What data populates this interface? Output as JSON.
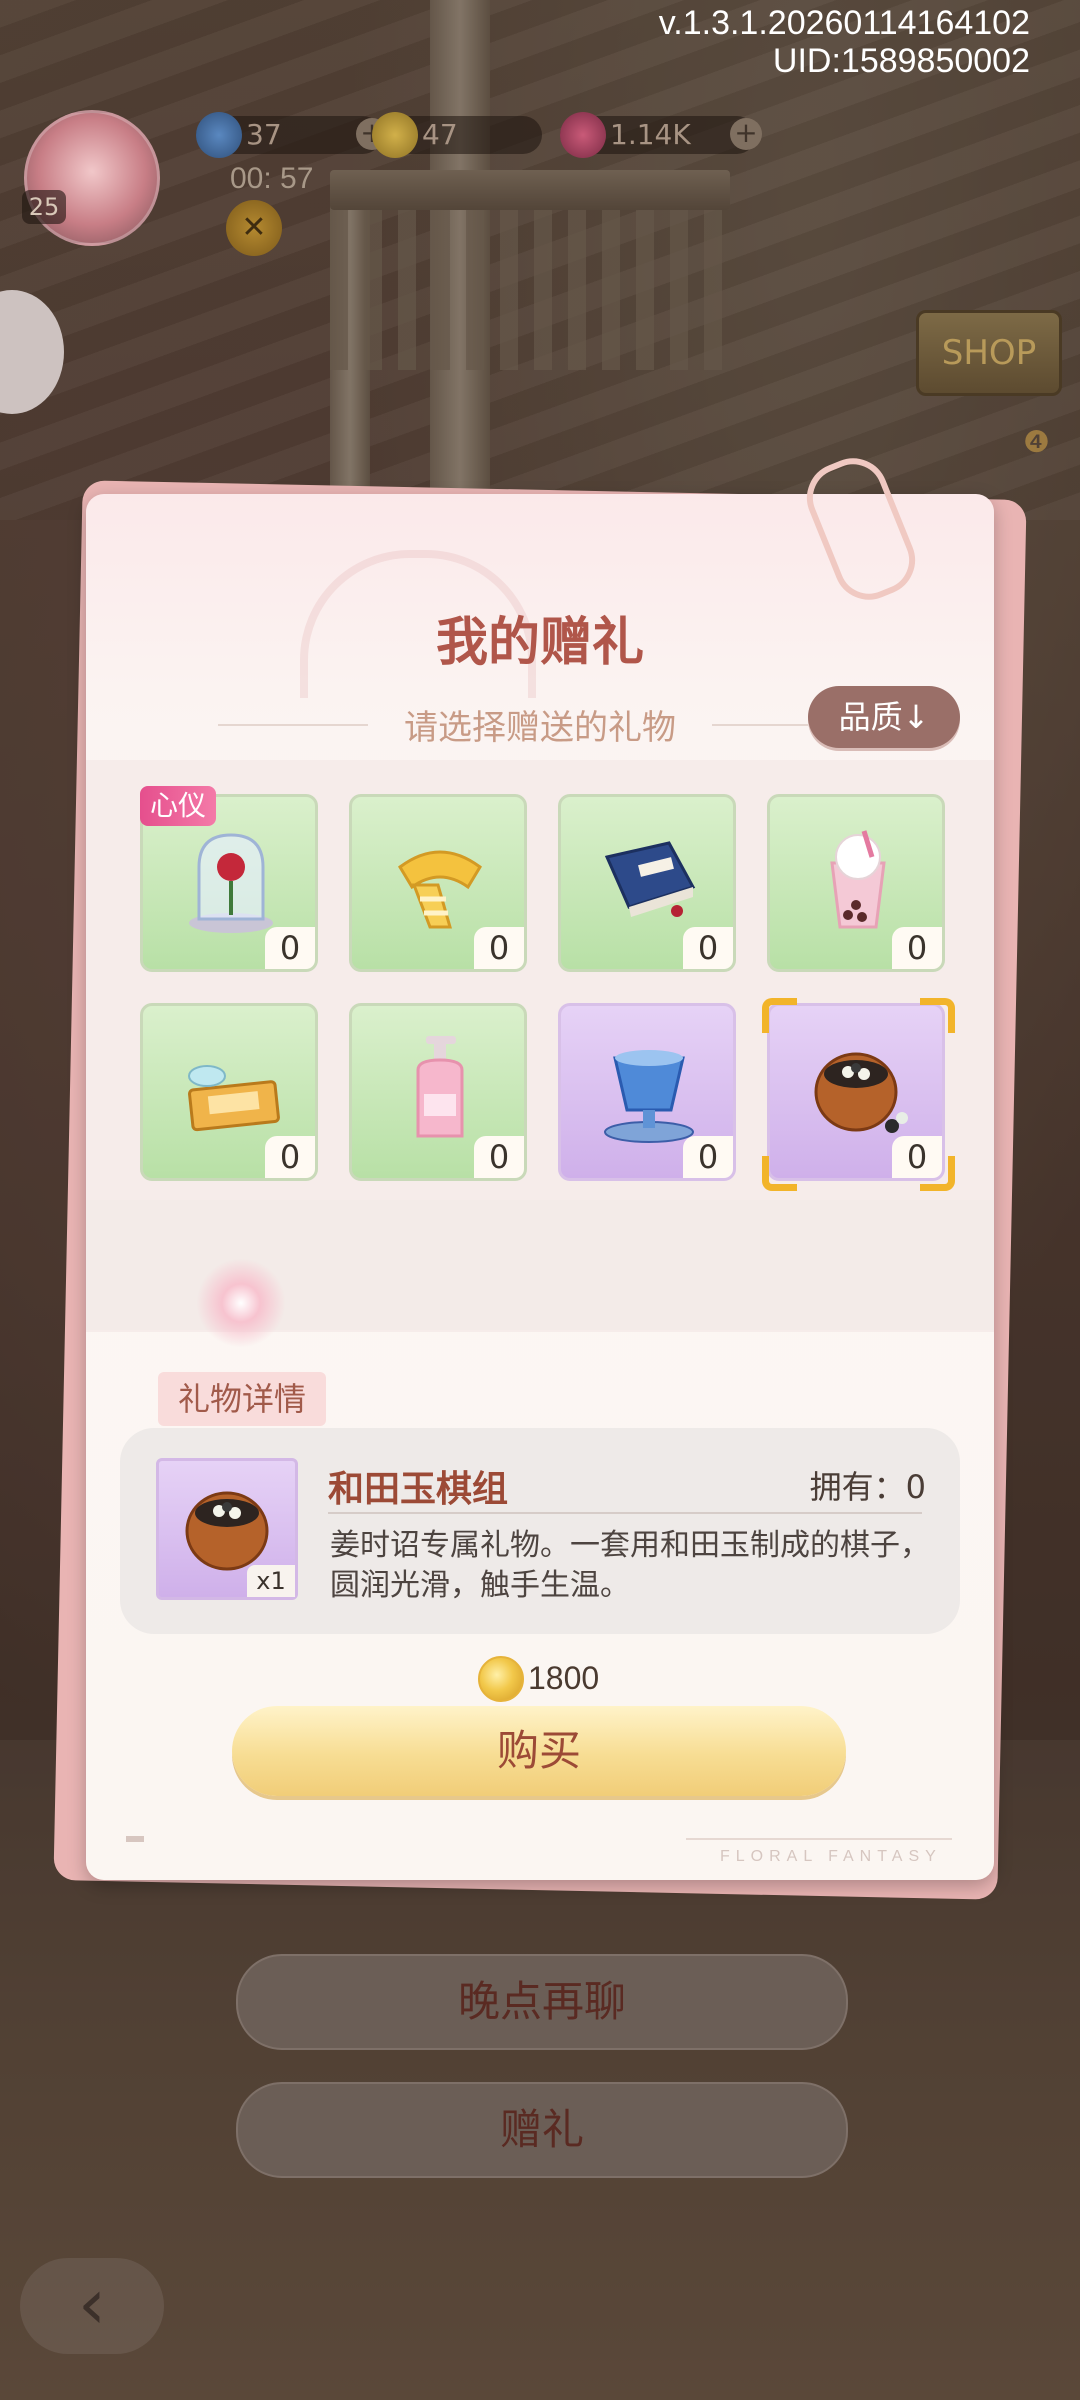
{
  "hud": {
    "version": "v.1.3.1.20260114164102",
    "uid": "UID:1589850002",
    "level": "25",
    "energy": "37",
    "coins": "47",
    "gems": "1.14K",
    "timer": "00: 57"
  },
  "modal": {
    "title": "我的赠礼",
    "subtitle": "请选择赠送的礼物",
    "sort_label": "品质↓",
    "items": [
      {
        "icon": "rose-dome-icon",
        "count": "0",
        "tag": "心仪",
        "style": "green"
      },
      {
        "icon": "scarf-icon",
        "count": "0",
        "style": "green"
      },
      {
        "icon": "book-icon",
        "count": "0",
        "style": "green"
      },
      {
        "icon": "milk-tea-icon",
        "count": "0",
        "style": "green"
      },
      {
        "icon": "wish-ticket-icon",
        "count": "0",
        "style": "green"
      },
      {
        "icon": "lotion-bottle-icon",
        "count": "0",
        "style": "green"
      },
      {
        "icon": "crystal-cup-icon",
        "count": "0",
        "style": "purple"
      },
      {
        "icon": "go-stones-icon",
        "count": "0",
        "style": "purple",
        "selected": true
      }
    ],
    "detail": {
      "tab_label": "礼物详情",
      "name": "和田玉棋组",
      "owned": "拥有：0",
      "qty": "x1",
      "desc": "姜时诏专属礼物。一套用和田玉制成的棋子，圆润光滑，触手生温。",
      "price": "1800"
    },
    "buy_label": "购买",
    "footer_brand": "FLORAL   FANTASY"
  },
  "bottom": {
    "later_label": "晚点再聊",
    "gift_label": "赠礼"
  },
  "colors": {
    "title": "#b0564a",
    "accent_gold": "#f2b42a",
    "tag_pink": "#e54f8d",
    "green_tile": "#b8e0a6",
    "purple_tile": "#cfb0ea"
  }
}
